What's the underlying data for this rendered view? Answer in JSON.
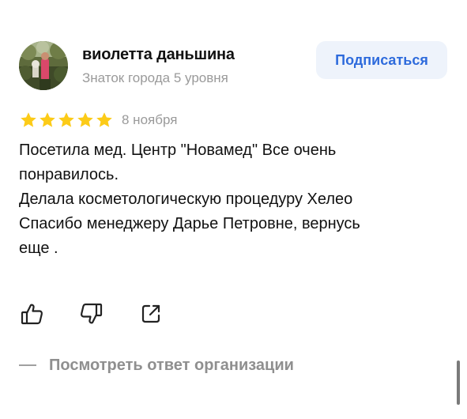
{
  "author": {
    "name": "виолетта даньшина",
    "level": "Знаток города 5 уровня"
  },
  "subscribe": {
    "label": "Подписаться"
  },
  "rating": {
    "stars": 5,
    "max": 5,
    "color": "#fccb18"
  },
  "review": {
    "date": "8 ноября",
    "lines": [
      "Посетила мед. Центр \"Новамед\" Все очень",
      "понравилось.",
      "Делала косметологическую процедуру Хелео",
      "Спасибо менеджеру Дарье Петровне, вернусь",
      "еще ."
    ]
  },
  "actions": {
    "like_icon": "thumb-up-icon",
    "dislike_icon": "thumb-down-icon",
    "share_icon": "share-icon"
  },
  "org_reply": {
    "label": "Посмотреть ответ организации"
  },
  "colors": {
    "accent": "#2e6bdc",
    "subscribe_bg": "#eef3fb",
    "muted_text": "#9a9a9a",
    "star": "#fccb18"
  }
}
